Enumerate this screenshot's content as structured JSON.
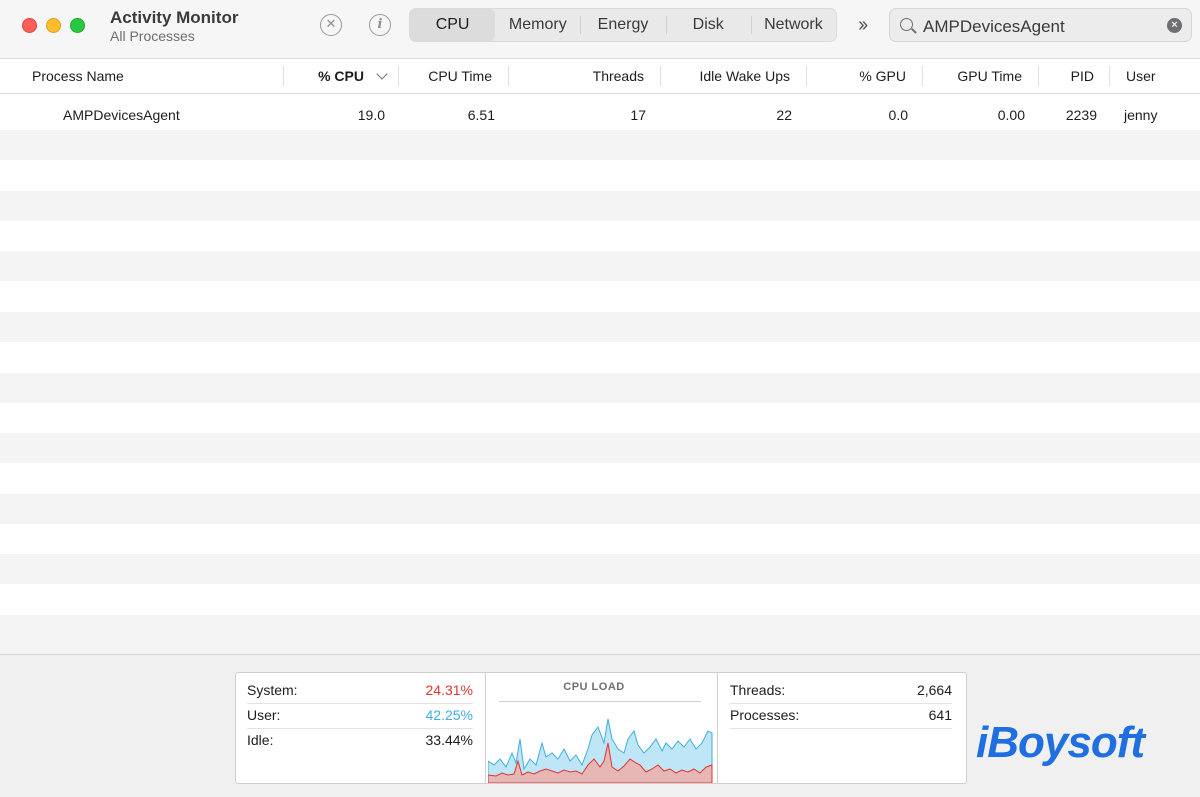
{
  "window": {
    "title": "Activity Monitor",
    "subtitle": "All Processes"
  },
  "toolbar": {
    "stop_icon": "xmark-circle-icon",
    "info_icon": "info-circle-icon",
    "tabs": [
      "CPU",
      "Memory",
      "Energy",
      "Disk",
      "Network"
    ],
    "active_tab": "CPU",
    "more_icon": "chevron-double-right-icon"
  },
  "search": {
    "value": "AMPDevicesAgent"
  },
  "table": {
    "columns": [
      "Process Name",
      "% CPU",
      "CPU Time",
      "Threads",
      "Idle Wake Ups",
      "% GPU",
      "GPU Time",
      "PID",
      "User"
    ],
    "sorted_column": "% CPU",
    "rows": [
      {
        "process_name": "AMPDevicesAgent",
        "cpu_percent": "19.0",
        "cpu_time": "6.51",
        "threads": "17",
        "idle_wake_ups": "22",
        "gpu_percent": "0.0",
        "gpu_time": "0.00",
        "pid": "2239",
        "user": "jenny"
      }
    ]
  },
  "summary": {
    "system_label": "System:",
    "system_value": "24.31%",
    "user_label": "User:",
    "user_value": "42.25%",
    "idle_label": "Idle:",
    "idle_value": "33.44%",
    "cpu_load_title": "CPU LOAD",
    "threads_label": "Threads:",
    "threads_value": "2,664",
    "processes_label": "Processes:",
    "processes_value": "641"
  },
  "colors": {
    "system": "#e0342f",
    "user": "#3eaee0"
  },
  "watermark": "iBoysoft"
}
